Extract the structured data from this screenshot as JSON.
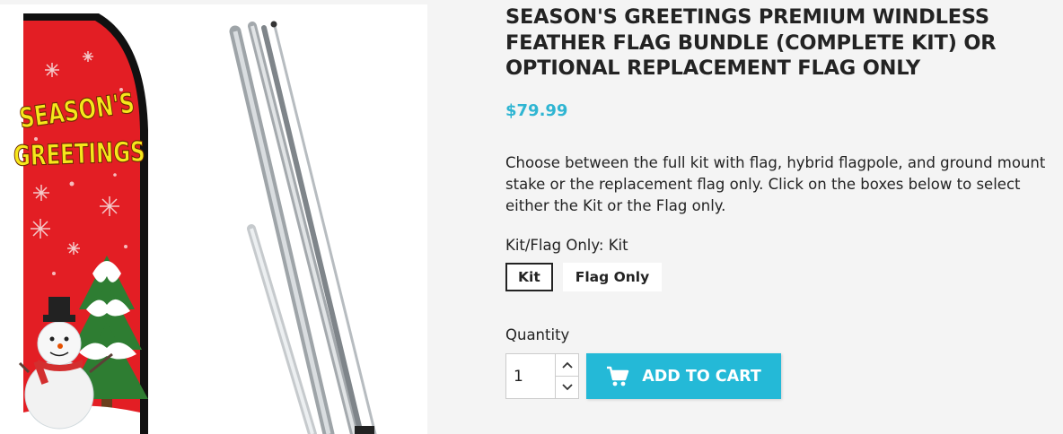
{
  "product": {
    "title": "SEASON'S GREETINGS PREMIUM WINDLESS FEATHER FLAG BUNDLE (COMPLETE KIT) OR OPTIONAL REPLACEMENT FLAG ONLY",
    "price": "$79.99",
    "description": "Choose between the full kit with flag, hybrid flagpole, and ground mount stake or the replacement flag only. Click on the boxes below to select either the Kit or the Flag only.",
    "image_text": {
      "line1": "SEASON'S",
      "line2": "GREETINGS"
    }
  },
  "variant": {
    "label": "Kit/Flag Only: Kit",
    "options": [
      {
        "label": "Kit",
        "selected": true
      },
      {
        "label": "Flag Only",
        "selected": false
      }
    ]
  },
  "quantity": {
    "label": "Quantity",
    "value": "1"
  },
  "cart": {
    "add_label": "ADD TO CART",
    "icon": "shopping-cart-icon"
  },
  "colors": {
    "accent": "#24b9d7",
    "price": "#2fb5d2",
    "flag_red": "#e31e24",
    "flag_text": "#f6e71b"
  }
}
